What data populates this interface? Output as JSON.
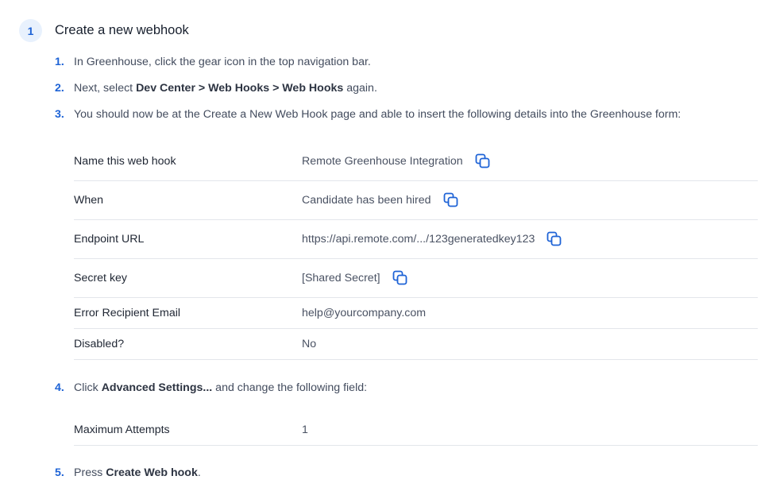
{
  "step": {
    "number": "1",
    "title": "Create a new webhook"
  },
  "instructions": [
    {
      "num": "1.",
      "parts": [
        {
          "text": "In Greenhouse, click the gear icon in the top navigation bar.",
          "bold": false
        }
      ]
    },
    {
      "num": "2.",
      "parts": [
        {
          "text": "Next, select ",
          "bold": false
        },
        {
          "text": "Dev Center > Web Hooks > Web Hooks",
          "bold": true
        },
        {
          "text": " again.",
          "bold": false
        }
      ]
    },
    {
      "num": "3.",
      "parts": [
        {
          "text": "You should now be at the Create a New Web Hook page and able to insert the following details into the Greenhouse form:",
          "bold": false
        }
      ]
    },
    {
      "num": "4.",
      "parts": [
        {
          "text": "Click ",
          "bold": false
        },
        {
          "text": "Advanced Settings...",
          "bold": true
        },
        {
          "text": " and change the following field:",
          "bold": false
        }
      ]
    },
    {
      "num": "5.",
      "parts": [
        {
          "text": "Press ",
          "bold": false
        },
        {
          "text": "Create Web hook",
          "bold": true
        },
        {
          "text": ".",
          "bold": false
        }
      ]
    }
  ],
  "webhook_fields": [
    {
      "label": "Name this web hook",
      "value": "Remote Greenhouse Integration",
      "copyable": true
    },
    {
      "label": "When",
      "value": "Candidate has been hired",
      "copyable": true
    },
    {
      "label": "Endpoint URL",
      "value": "https://api.remote.com/.../123generatedkey123",
      "copyable": true
    },
    {
      "label": "Secret key",
      "value": "[Shared Secret]",
      "copyable": true
    },
    {
      "label": "Error Recipient Email",
      "value": "help@yourcompany.com",
      "copyable": false
    },
    {
      "label": "Disabled?",
      "value": "No",
      "copyable": false
    }
  ],
  "advanced_fields": [
    {
      "label": "Maximum Attempts",
      "value": "1",
      "copyable": false
    }
  ],
  "icons": {
    "copy": "copy-icon"
  },
  "colors": {
    "accent": "#1e63d6",
    "badge_bg": "#e8f1fd",
    "divider": "#e3e6eb"
  }
}
